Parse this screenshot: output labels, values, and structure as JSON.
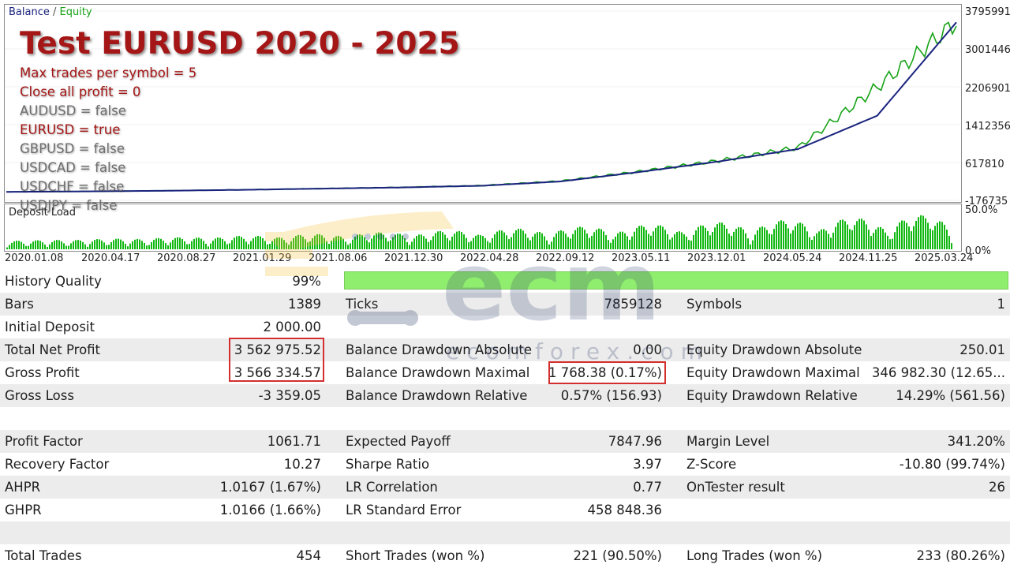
{
  "chart": {
    "legend_balance": "Balance",
    "legend_separator": " / ",
    "legend_equity": "Equity",
    "title": "Test EURUSD 2020 - 2025",
    "params": [
      {
        "text": "Max trades per symbol = 5",
        "color": "red"
      },
      {
        "text": "Close all profit = 0",
        "color": "red"
      },
      {
        "text": "AUDUSD = false",
        "color": "gray"
      },
      {
        "text": "EURUSD = true",
        "color": "red"
      },
      {
        "text": "GBPUSD = false",
        "color": "gray"
      },
      {
        "text": "USDCAD = false",
        "color": "gray"
      },
      {
        "text": "USDCHF = false",
        "color": "gray"
      },
      {
        "text": "USDJPY = false",
        "color": "gray"
      }
    ],
    "deposit_label": "Deposit Load",
    "y_ticks": [
      "3795991",
      "3001446",
      "2206901",
      "1412356",
      "617810",
      "-176735"
    ],
    "deposit_ticks": [
      "50.0%",
      "0.0%"
    ],
    "x_ticks": [
      "2020.01.08",
      "2020.04.17",
      "2020.08.27",
      "2021.01.29",
      "2021.08.06",
      "2021.12.30",
      "2022.04.28",
      "2022.09.12",
      "2023.05.11",
      "2023.12.01",
      "2024.05.24",
      "2024.11.25",
      "2025.03.24"
    ],
    "colors": {
      "balance": "#1a237e",
      "equity": "#17a317",
      "deposit": "#11b811",
      "title": "#a51616"
    }
  },
  "chart_data": {
    "type": "line",
    "x": [
      "2020.01.08",
      "2020.04.17",
      "2020.08.27",
      "2021.01.29",
      "2021.08.06",
      "2021.12.30",
      "2022.04.28",
      "2022.09.12",
      "2023.05.11",
      "2023.12.01",
      "2024.05.24",
      "2024.11.25",
      "2025.03.24"
    ],
    "series": [
      {
        "name": "Balance",
        "values": [
          2000,
          12000,
          25000,
          45000,
          70000,
          95000,
          130000,
          220000,
          420000,
          640000,
          900000,
          1600000,
          3560000
        ]
      },
      {
        "name": "Equity",
        "values": [
          2000,
          12500,
          26000,
          46000,
          72000,
          97000,
          133000,
          228000,
          430000,
          655000,
          930000,
          2200000,
          3565000
        ]
      }
    ],
    "ylim": [
      -176735,
      3795991
    ]
  },
  "history_quality": {
    "label": "History Quality",
    "value": "99%"
  },
  "rows": [
    [
      {
        "label": "Bars",
        "value": "1389"
      },
      {
        "label": "Ticks",
        "value": "7859128"
      },
      {
        "label": "Symbols",
        "value": "1"
      }
    ],
    [
      {
        "label": "Initial Deposit",
        "value": "2 000.00"
      },
      {
        "label": "",
        "value": ""
      },
      {
        "label": "",
        "value": ""
      }
    ],
    [
      {
        "label": "Total Net Profit",
        "value": "3 562 975.52"
      },
      {
        "label": "Balance Drawdown Absolute",
        "value": "0.00"
      },
      {
        "label": "Equity Drawdown Absolute",
        "value": "250.01"
      }
    ],
    [
      {
        "label": "Gross Profit",
        "value": "3 566 334.57"
      },
      {
        "label": "Balance Drawdown Maximal",
        "value": "1 768.38 (0.17%)"
      },
      {
        "label": "Equity Drawdown Maximal",
        "value": "346 982.30 (12.65..."
      }
    ],
    [
      {
        "label": "Gross Loss",
        "value": "-3 359.05"
      },
      {
        "label": "Balance Drawdown Relative",
        "value": "0.57% (156.93)"
      },
      {
        "label": "Equity Drawdown Relative",
        "value": "14.29% (561.56)"
      }
    ],
    [
      {
        "label": "",
        "value": ""
      },
      {
        "label": "",
        "value": ""
      },
      {
        "label": "",
        "value": ""
      }
    ],
    [
      {
        "label": "Profit Factor",
        "value": "1061.71"
      },
      {
        "label": "Expected Payoff",
        "value": "7847.96"
      },
      {
        "label": "Margin Level",
        "value": "341.20%"
      }
    ],
    [
      {
        "label": "Recovery Factor",
        "value": "10.27"
      },
      {
        "label": "Sharpe Ratio",
        "value": "3.97"
      },
      {
        "label": "Z-Score",
        "value": "-10.80 (99.74%)"
      }
    ],
    [
      {
        "label": "AHPR",
        "value": "1.0167 (1.67%)"
      },
      {
        "label": "LR Correlation",
        "value": "0.77"
      },
      {
        "label": "OnTester result",
        "value": "26"
      }
    ],
    [
      {
        "label": "GHPR",
        "value": "1.0166 (1.66%)"
      },
      {
        "label": "LR Standard Error",
        "value": "458 848.36"
      },
      {
        "label": "",
        "value": ""
      }
    ],
    [
      {
        "label": "",
        "value": ""
      },
      {
        "label": "",
        "value": ""
      },
      {
        "label": "",
        "value": ""
      }
    ],
    [
      {
        "label": "Total Trades",
        "value": "454"
      },
      {
        "label": "Short Trades (won %)",
        "value": "221 (90.50%)"
      },
      {
        "label": "Long Trades (won %)",
        "value": "233 (80.26%)"
      }
    ]
  ],
  "watermark": {
    "text": "ecomforex.com",
    "colors": {
      "yellow": "#f5c542",
      "gray": "#2c3e6b"
    }
  }
}
